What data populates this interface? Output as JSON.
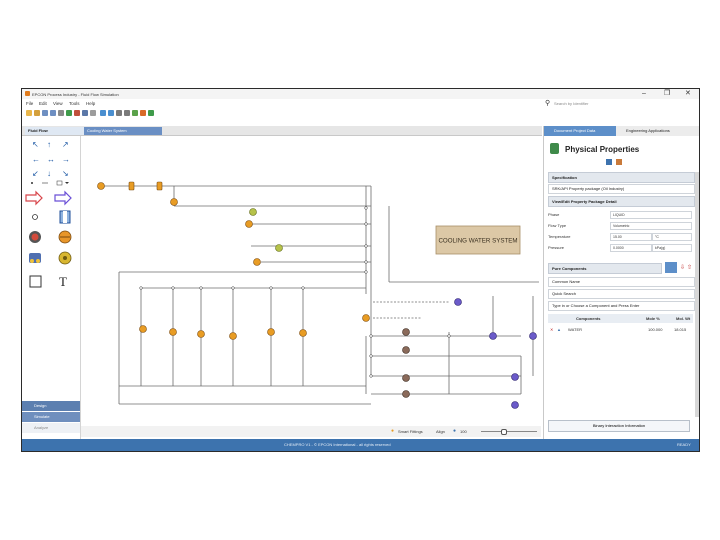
{
  "app": {
    "title": "EPCON Process Industry - Fluid Flow Simulation",
    "window_controls": {
      "minimize": "–",
      "maximize": "❐",
      "close": "✕"
    }
  },
  "menu": [
    "File",
    "Edit",
    "View",
    "Tools",
    "Help"
  ],
  "search": {
    "placeholder": "Search by Identifier"
  },
  "tabs": {
    "panel": "Fluid Flow",
    "document": "Cooling Water System"
  },
  "palette": {
    "arrows": [
      "↖",
      "↑",
      "↗",
      "←",
      "↔",
      "→",
      "↙",
      "↓",
      "↘"
    ],
    "text_tool": "T"
  },
  "sidebar_buttons": {
    "design": "Design",
    "simulate": "Simulate",
    "analyze": "Analyze"
  },
  "canvas": {
    "label_box": "COOLING WATER SYSTEM",
    "label_color": "#dcc8a6"
  },
  "zoom_bar": {
    "snap": "Smart Fittings",
    "align": "Align",
    "zoom": "100"
  },
  "right_panel": {
    "tabs": [
      "Document Project Data",
      "Engineering Applications"
    ],
    "header": "Physical Properties",
    "specification_label": "Specification",
    "package": "SRK/API Property package (Oil Industry)",
    "view_edit": "View/Edit Property Package Detail",
    "properties": [
      {
        "name": "Phase",
        "value": "LIQUID",
        "unit": ""
      },
      {
        "name": "Flow Type",
        "value": "Volumetric",
        "unit": ""
      },
      {
        "name": "Temperature",
        "value": "15.00",
        "unit": "°C"
      },
      {
        "name": "Pressure",
        "value": "0.0000",
        "unit": "kPa(g)"
      }
    ],
    "pure_components_label": "Pure Components",
    "common_name": "Common Name",
    "quick_search": "Quick Search",
    "type_prompt": "Type in or Choose a Component and Press Enter",
    "columns": [
      "Components",
      "Mole %",
      "Mol. Wt"
    ],
    "components": [
      {
        "name": "WATER",
        "mole": "100.000",
        "mw": "18.015"
      }
    ],
    "binary_button": "Binary Interaction Information"
  },
  "statusbar": {
    "text": "CHEMPRO V1 - © EPCON International - all rights reserved",
    "right": "READY"
  },
  "colors": {
    "accent": "#3d73ae",
    "pipe": "#6b6b6b",
    "pump": "#e89c24",
    "valve": "#b6c24a",
    "vessel": "#6b5bc9"
  }
}
